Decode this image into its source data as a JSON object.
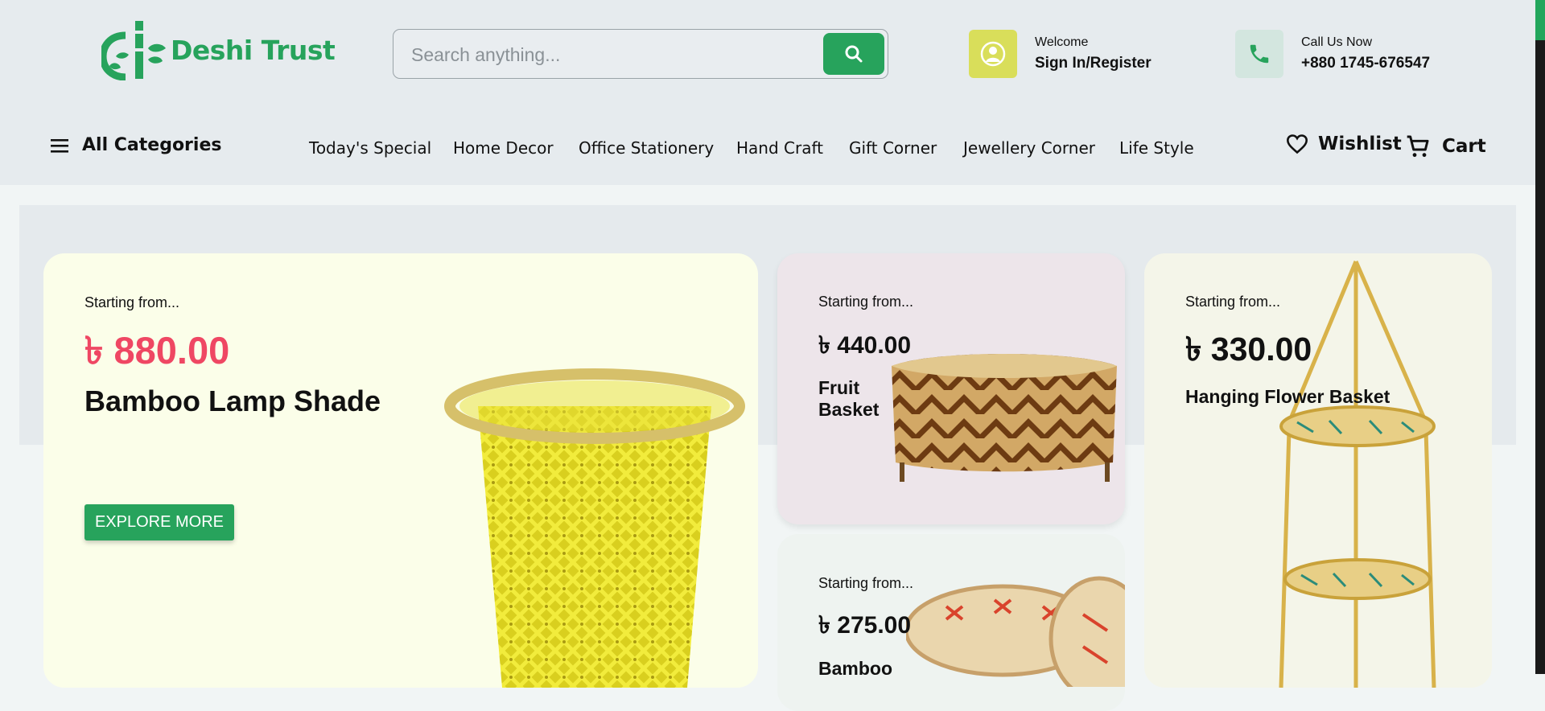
{
  "brand": {
    "name": "Deshi Trust",
    "color": "#27a35c"
  },
  "search": {
    "placeholder": "Search anything...",
    "icon": "search-icon"
  },
  "account": {
    "welcome": "Welcome",
    "action": "Sign In/Register",
    "icon": "user-icon"
  },
  "contact": {
    "label": "Call Us Now",
    "phone": "+880 1745-676547",
    "icon": "phone-icon"
  },
  "nav": {
    "all_categories": "All Categories",
    "items": [
      "Today's Special",
      "Home Decor",
      "Office Stationery",
      "Hand Craft",
      "Gift Corner",
      "Jewellery Corner",
      "Life Style"
    ],
    "wishlist": "Wishlist",
    "cart": "Cart"
  },
  "cards": [
    {
      "starting": "Starting from...",
      "price": "৳ 880.00",
      "title": "Bamboo Lamp Shade",
      "button": "EXPLORE MORE",
      "bg": "#fbfee9"
    },
    {
      "starting": "Starting from...",
      "price": "৳ 440.00",
      "title": "Fruit Basket",
      "bg": "#ede5ea"
    },
    {
      "starting": "Starting from...",
      "price": "৳ 330.00",
      "title": "Hanging Flower Basket",
      "bg": "#f4f5e9"
    },
    {
      "starting": "Starting from...",
      "price": "৳ 275.00",
      "title": "Bamboo",
      "bg": "#eef3f0"
    }
  ]
}
